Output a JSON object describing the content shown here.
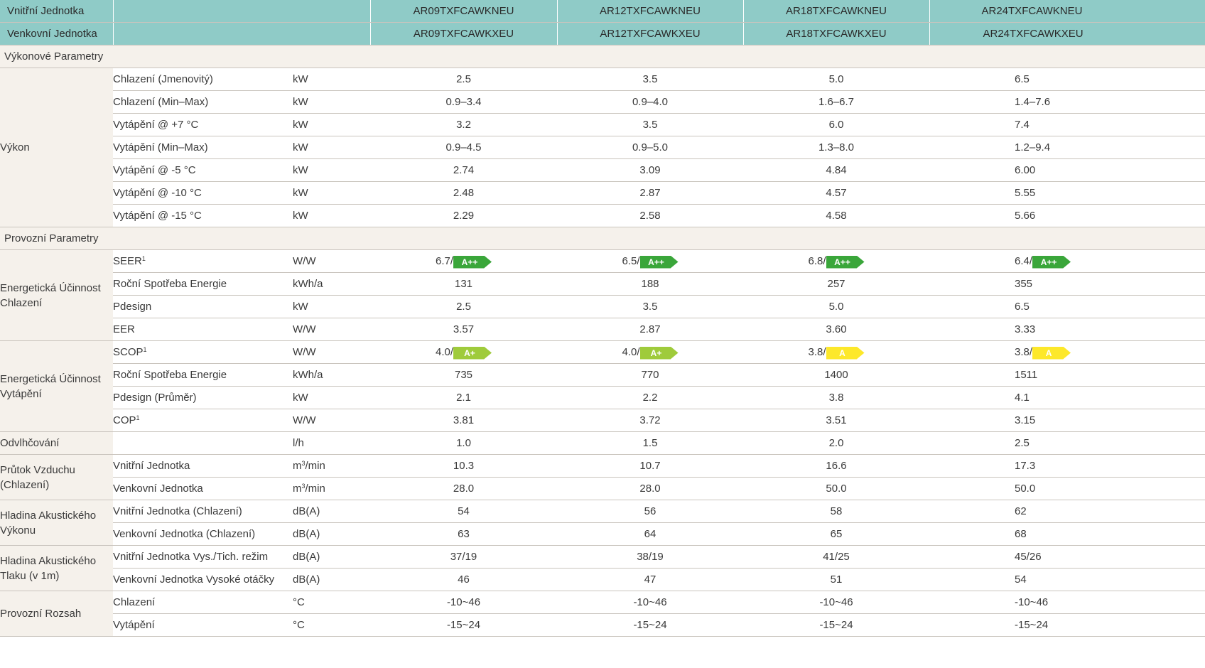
{
  "header": {
    "row1_label": "Vnitřní Jednotka",
    "row2_label": "Venkovní Jednotka",
    "indoor_models": [
      "AR09TXFCAWKNEU",
      "AR12TXFCAWKNEU",
      "AR18TXFCAWKNEU",
      "AR24TXFCAWKNEU"
    ],
    "outdoor_models": [
      "AR09TXFCAWKXEU",
      "AR12TXFCAWKXEU",
      "AR18TXFCAWKXEU",
      "AR24TXFCAWKXEU"
    ]
  },
  "colors": {
    "header_bg": "#8fcbc7",
    "category_bg": "#f5f1eb",
    "badge_a_plus_plus": "#3aa63a",
    "badge_a_plus": "#9fcb3b",
    "badge_a": "#fde82a"
  },
  "groups": [
    {
      "section": "Výkonové Parametry",
      "blocks": [
        {
          "category": [
            "Výkon"
          ],
          "rows": [
            {
              "param": "Chlazení (Jmenovitý)",
              "unit": "kW",
              "values": [
                "2.5",
                "3.5",
                "5.0",
                "6.5"
              ]
            },
            {
              "param": "Chlazení (Min–Max)",
              "unit": "kW",
              "values": [
                "0.9–3.4",
                "0.9–4.0",
                "1.6–6.7",
                "1.4–7.6"
              ]
            },
            {
              "param": "Vytápění @ +7 °C",
              "unit": "kW",
              "values": [
                "3.2",
                "3.5",
                "6.0",
                "7.4"
              ]
            },
            {
              "param": "Vytápění (Min–Max)",
              "unit": "kW",
              "values": [
                "0.9–4.5",
                "0.9–5.0",
                "1.3–8.0",
                "1.2–9.4"
              ]
            },
            {
              "param": "Vytápění @ -5 °C",
              "unit": "kW",
              "values": [
                "2.74",
                "3.09",
                "4.84",
                "6.00"
              ]
            },
            {
              "param": "Vytápění @ -10 °C",
              "unit": "kW",
              "values": [
                "2.48",
                "2.87",
                "4.57",
                "5.55"
              ]
            },
            {
              "param": "Vytápění @ -15 °C",
              "unit": "kW",
              "values": [
                "2.29",
                "2.58",
                "4.58",
                "5.66"
              ]
            }
          ]
        }
      ]
    },
    {
      "section": "Provozní Parametry",
      "blocks": [
        {
          "category": [
            "Energetická Účinnost",
            "Chlazení"
          ],
          "rows": [
            {
              "param": "SEER",
              "sup": "1",
              "unit": "W/W",
              "rating": true,
              "values": [
                "6.7/",
                "6.5/",
                "6.8/",
                "6.4/"
              ],
              "badges": [
                {
                  "label": "A++",
                  "color": "#3aa63a"
                },
                {
                  "label": "A++",
                  "color": "#3aa63a"
                },
                {
                  "label": "A++",
                  "color": "#3aa63a"
                },
                {
                  "label": "A++",
                  "color": "#3aa63a"
                }
              ]
            },
            {
              "param": "Roční Spotřeba Energie",
              "unit": "kWh/a",
              "values": [
                "131",
                "188",
                "257",
                "355"
              ]
            },
            {
              "param": "Pdesign",
              "unit": "kW",
              "values": [
                "2.5",
                "3.5",
                "5.0",
                "6.5"
              ]
            },
            {
              "param": "EER",
              "unit": "W/W",
              "values": [
                "3.57",
                "2.87",
                "3.60",
                "3.33"
              ]
            }
          ]
        },
        {
          "category": [
            "Energetická Účinnost",
            "Vytápění"
          ],
          "rows": [
            {
              "param": "SCOP",
              "sup": "1",
              "unit": "W/W",
              "rating": true,
              "values": [
                "4.0/",
                "4.0/",
                "3.8/",
                "3.8/"
              ],
              "badges": [
                {
                  "label": "A+",
                  "color": "#9fcb3b"
                },
                {
                  "label": "A+",
                  "color": "#9fcb3b"
                },
                {
                  "label": "A",
                  "color": "#fde82a"
                },
                {
                  "label": "A",
                  "color": "#fde82a"
                }
              ]
            },
            {
              "param": "Roční Spotřeba Energie",
              "unit": "kWh/a",
              "values": [
                "735",
                "770",
                "1400",
                "1511"
              ]
            },
            {
              "param": "Pdesign (Průměr)",
              "unit": "kW",
              "values": [
                "2.1",
                "2.2",
                "3.8",
                "4.1"
              ]
            },
            {
              "param": "COP",
              "sup": "1",
              "unit": "W/W",
              "values": [
                "3.81",
                "3.72",
                "3.51",
                "3.15"
              ]
            }
          ]
        },
        {
          "category": [
            "Odvlhčování"
          ],
          "rows": [
            {
              "param": "",
              "unit": "l/h",
              "values": [
                "1.0",
                "1.5",
                "2.0",
                "2.5"
              ]
            }
          ]
        },
        {
          "category": [
            "Průtok Vzduchu",
            "(Chlazení)"
          ],
          "rows": [
            {
              "param": "Vnitřní Jednotka",
              "unit": "m",
              "unit_sup": "3",
              "unit_suffix": "/min",
              "values": [
                "10.3",
                "10.7",
                "16.6",
                "17.3"
              ]
            },
            {
              "param": "Venkovní Jednotka",
              "unit": "m",
              "unit_sup": "3",
              "unit_suffix": "/min",
              "values": [
                "28.0",
                "28.0",
                "50.0",
                "50.0"
              ]
            }
          ]
        },
        {
          "category": [
            "Hladina Akustického",
            "Výkonu"
          ],
          "rows": [
            {
              "param": "Vnitřní Jednotka (Chlazení)",
              "unit": "dB(A)",
              "values": [
                "54",
                "56",
                "58",
                "62"
              ]
            },
            {
              "param": "Venkovní Jednotka (Chlazení)",
              "unit": "dB(A)",
              "values": [
                "63",
                "64",
                "65",
                "68"
              ]
            }
          ]
        },
        {
          "category": [
            "Hladina Akustického",
            "Tlaku (v 1m)"
          ],
          "rows": [
            {
              "param": "Vnitřní Jednotka Vys./Tich. režim",
              "unit": "dB(A)",
              "values": [
                "37/19",
                "38/19",
                "41/25",
                "45/26"
              ]
            },
            {
              "param": "Venkovní Jednotka Vysoké otáčky",
              "unit": "dB(A)",
              "values": [
                "46",
                "47",
                "51",
                "54"
              ]
            }
          ]
        },
        {
          "category": [
            "Provozní Rozsah"
          ],
          "rows": [
            {
              "param": "Chlazení",
              "unit": "°C",
              "values": [
                "-10~46",
                "-10~46",
                "-10~46",
                "-10~46"
              ]
            },
            {
              "param": "Vytápění",
              "unit": "°C",
              "values": [
                "-15~24",
                "-15~24",
                "-15~24",
                "-15~24"
              ]
            }
          ]
        }
      ]
    }
  ]
}
